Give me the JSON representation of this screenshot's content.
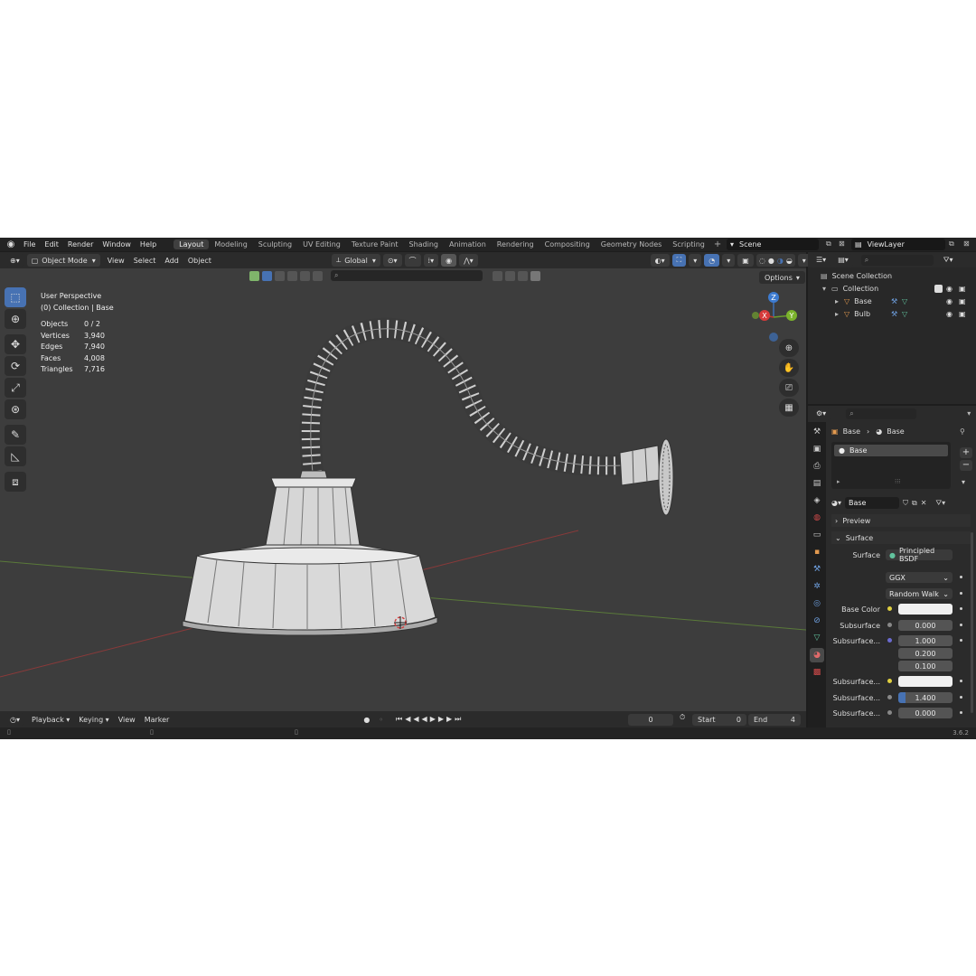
{
  "topbar": {
    "menus": [
      "File",
      "Edit",
      "Render",
      "Window",
      "Help"
    ],
    "workspaces": [
      "Layout",
      "Modeling",
      "Sculpting",
      "UV Editing",
      "Texture Paint",
      "Shading",
      "Animation",
      "Rendering",
      "Compositing",
      "Geometry Nodes",
      "Scripting"
    ],
    "active_workspace": "Layout",
    "scene": "Scene",
    "view_layer": "ViewLayer"
  },
  "viewport_header": {
    "mode": "Object Mode",
    "menus": [
      "View",
      "Select",
      "Add",
      "Object"
    ],
    "transform_orientation": "Global",
    "options": "Options"
  },
  "viewport": {
    "perspective": "User Perspective",
    "collection": "(0) Collection | Base",
    "stats": [
      {
        "label": "Objects",
        "value": "0 / 2"
      },
      {
        "label": "Vertices",
        "value": "3,940"
      },
      {
        "label": "Edges",
        "value": "7,940"
      },
      {
        "label": "Faces",
        "value": "4,008"
      },
      {
        "label": "Triangles",
        "value": "7,716"
      }
    ],
    "gizmo": {
      "x": "X",
      "y": "Y",
      "z": "Z"
    }
  },
  "timeline": {
    "menus": [
      "Playback",
      "Keying",
      "View",
      "Marker"
    ],
    "current_frame": "0",
    "start_label": "Start",
    "start": "0",
    "end_label": "End",
    "end": "4"
  },
  "status": {
    "version": "3.6.2"
  },
  "outliner": {
    "scene_collection": "Scene Collection",
    "collection": "Collection",
    "objects": [
      "Base",
      "Bulb"
    ]
  },
  "properties": {
    "breadcrumb": [
      "Base",
      "Base"
    ],
    "slot": "Base",
    "material_name": "Base",
    "panels": {
      "preview": "Preview",
      "surface": "Surface"
    },
    "surface_label": "Surface",
    "surface_shader": "Principled BSDF",
    "distribution": "GGX",
    "subsurface_method": "Random Walk",
    "fields": [
      {
        "label": "Base Color",
        "value": "",
        "type": "color"
      },
      {
        "label": "Subsurface",
        "value": "0.000"
      },
      {
        "label": "Subsurface...",
        "value": "1.000"
      },
      {
        "label": "",
        "value": "0.200"
      },
      {
        "label": "",
        "value": "0.100"
      },
      {
        "label": "Subsurface...",
        "value": "",
        "type": "color"
      },
      {
        "label": "Subsurface...",
        "value": "1.400"
      },
      {
        "label": "Subsurface...",
        "value": "0.000"
      }
    ]
  },
  "colors": {
    "accent": "#4772b3",
    "viewport_bg": "#3d3d3d",
    "panel_bg": "#2b2b2b"
  }
}
